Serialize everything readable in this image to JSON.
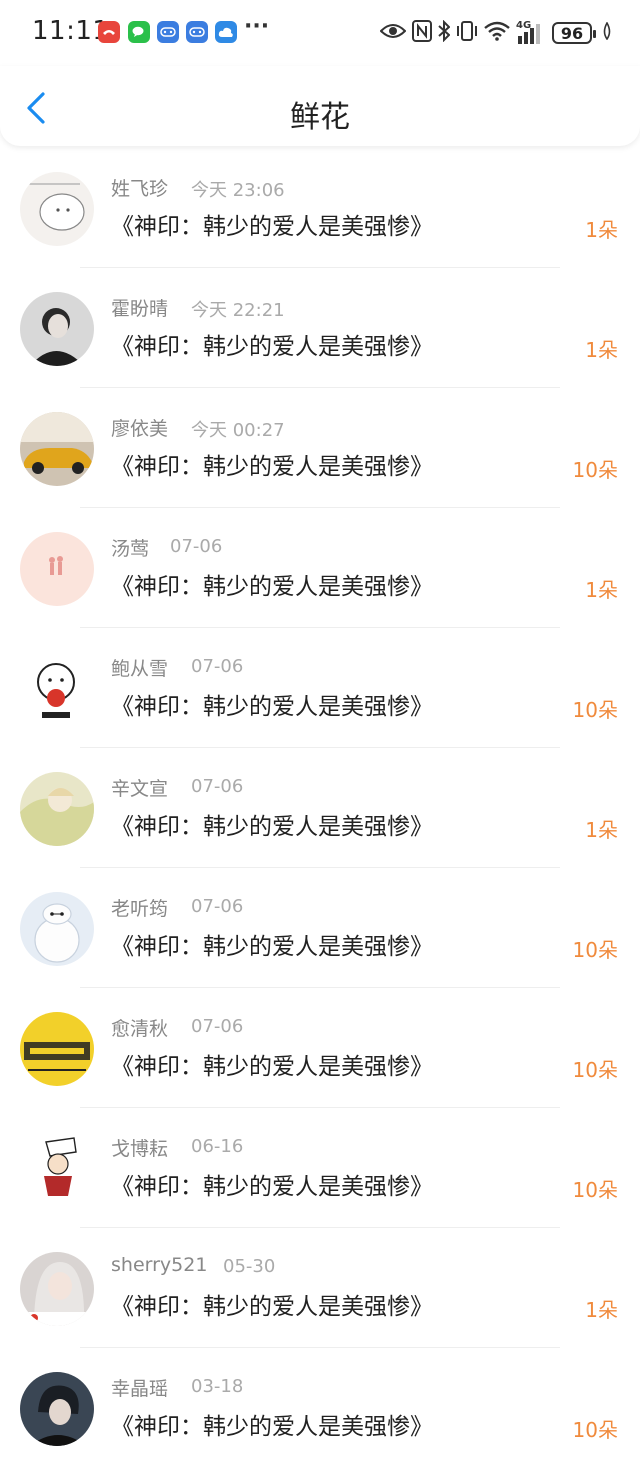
{
  "status_bar": {
    "time": "11:11",
    "more": "···",
    "network": "4G",
    "battery": "96",
    "app_icons": [
      "missed-call-icon",
      "wechat-icon",
      "game-controller-icon",
      "game-controller-icon",
      "cloud-icon"
    ],
    "app_colors": [
      "#e8453c",
      "#2bc04a",
      "#3b7de0",
      "#3b7de0",
      "#2f8ae5"
    ]
  },
  "header": {
    "title": "鲜花",
    "back_icon": "chevron-left-icon",
    "accent": "#1a8cf0"
  },
  "records": [
    {
      "name": "姓飞珍",
      "time": "今天 23:06",
      "book": "《神印：韩少的爱人是美强惨》",
      "amount": "1朵",
      "avatar_color": "#f4f1ee"
    },
    {
      "name": "霍盼晴",
      "time": "今天 22:21",
      "book": "《神印：韩少的爱人是美强惨》",
      "amount": "1朵",
      "avatar_color": "#5a5a5a"
    },
    {
      "name": "廖依美",
      "time": "今天 00:27",
      "book": "《神印：韩少的爱人是美强惨》",
      "amount": "10朵",
      "avatar_color": "#c89a2a"
    },
    {
      "name": "汤莺",
      "time": "07-06",
      "book": "《神印：韩少的爱人是美强惨》",
      "amount": "1朵",
      "avatar_color": "#fbe4dc"
    },
    {
      "name": "鲍从雪",
      "time": "07-06",
      "book": "《神印：韩少的爱人是美强惨》",
      "amount": "10朵",
      "avatar_color": "#ffffff"
    },
    {
      "name": "辛文宣",
      "time": "07-06",
      "book": "《神印：韩少的爱人是美强惨》",
      "amount": "1朵",
      "avatar_color": "#e8e6c8"
    },
    {
      "name": "老听筠",
      "time": "07-06",
      "book": "《神印：韩少的爱人是美强惨》",
      "amount": "10朵",
      "avatar_color": "#e6edf5"
    },
    {
      "name": "愈清秋",
      "time": "07-06",
      "book": "《神印：韩少的爱人是美强惨》",
      "amount": "10朵",
      "avatar_color": "#f2d02a"
    },
    {
      "name": "戈博耘",
      "time": "06-16",
      "book": "《神印：韩少的爱人是美强惨》",
      "amount": "10朵",
      "avatar_color": "#ffffff"
    },
    {
      "name": "sherry521",
      "time": "05-30",
      "book": "《神印：韩少的爱人是美强惨》",
      "amount": "1朵",
      "avatar_color": "#d9d4d2"
    },
    {
      "name": "幸晶瑶",
      "time": "03-18",
      "book": "《神印：韩少的爱人是美强惨》",
      "amount": "10朵",
      "avatar_color": "#3a4654"
    }
  ],
  "colors": {
    "amount": "#f08a3c",
    "name": "#888888",
    "time": "#aaaaaa"
  }
}
